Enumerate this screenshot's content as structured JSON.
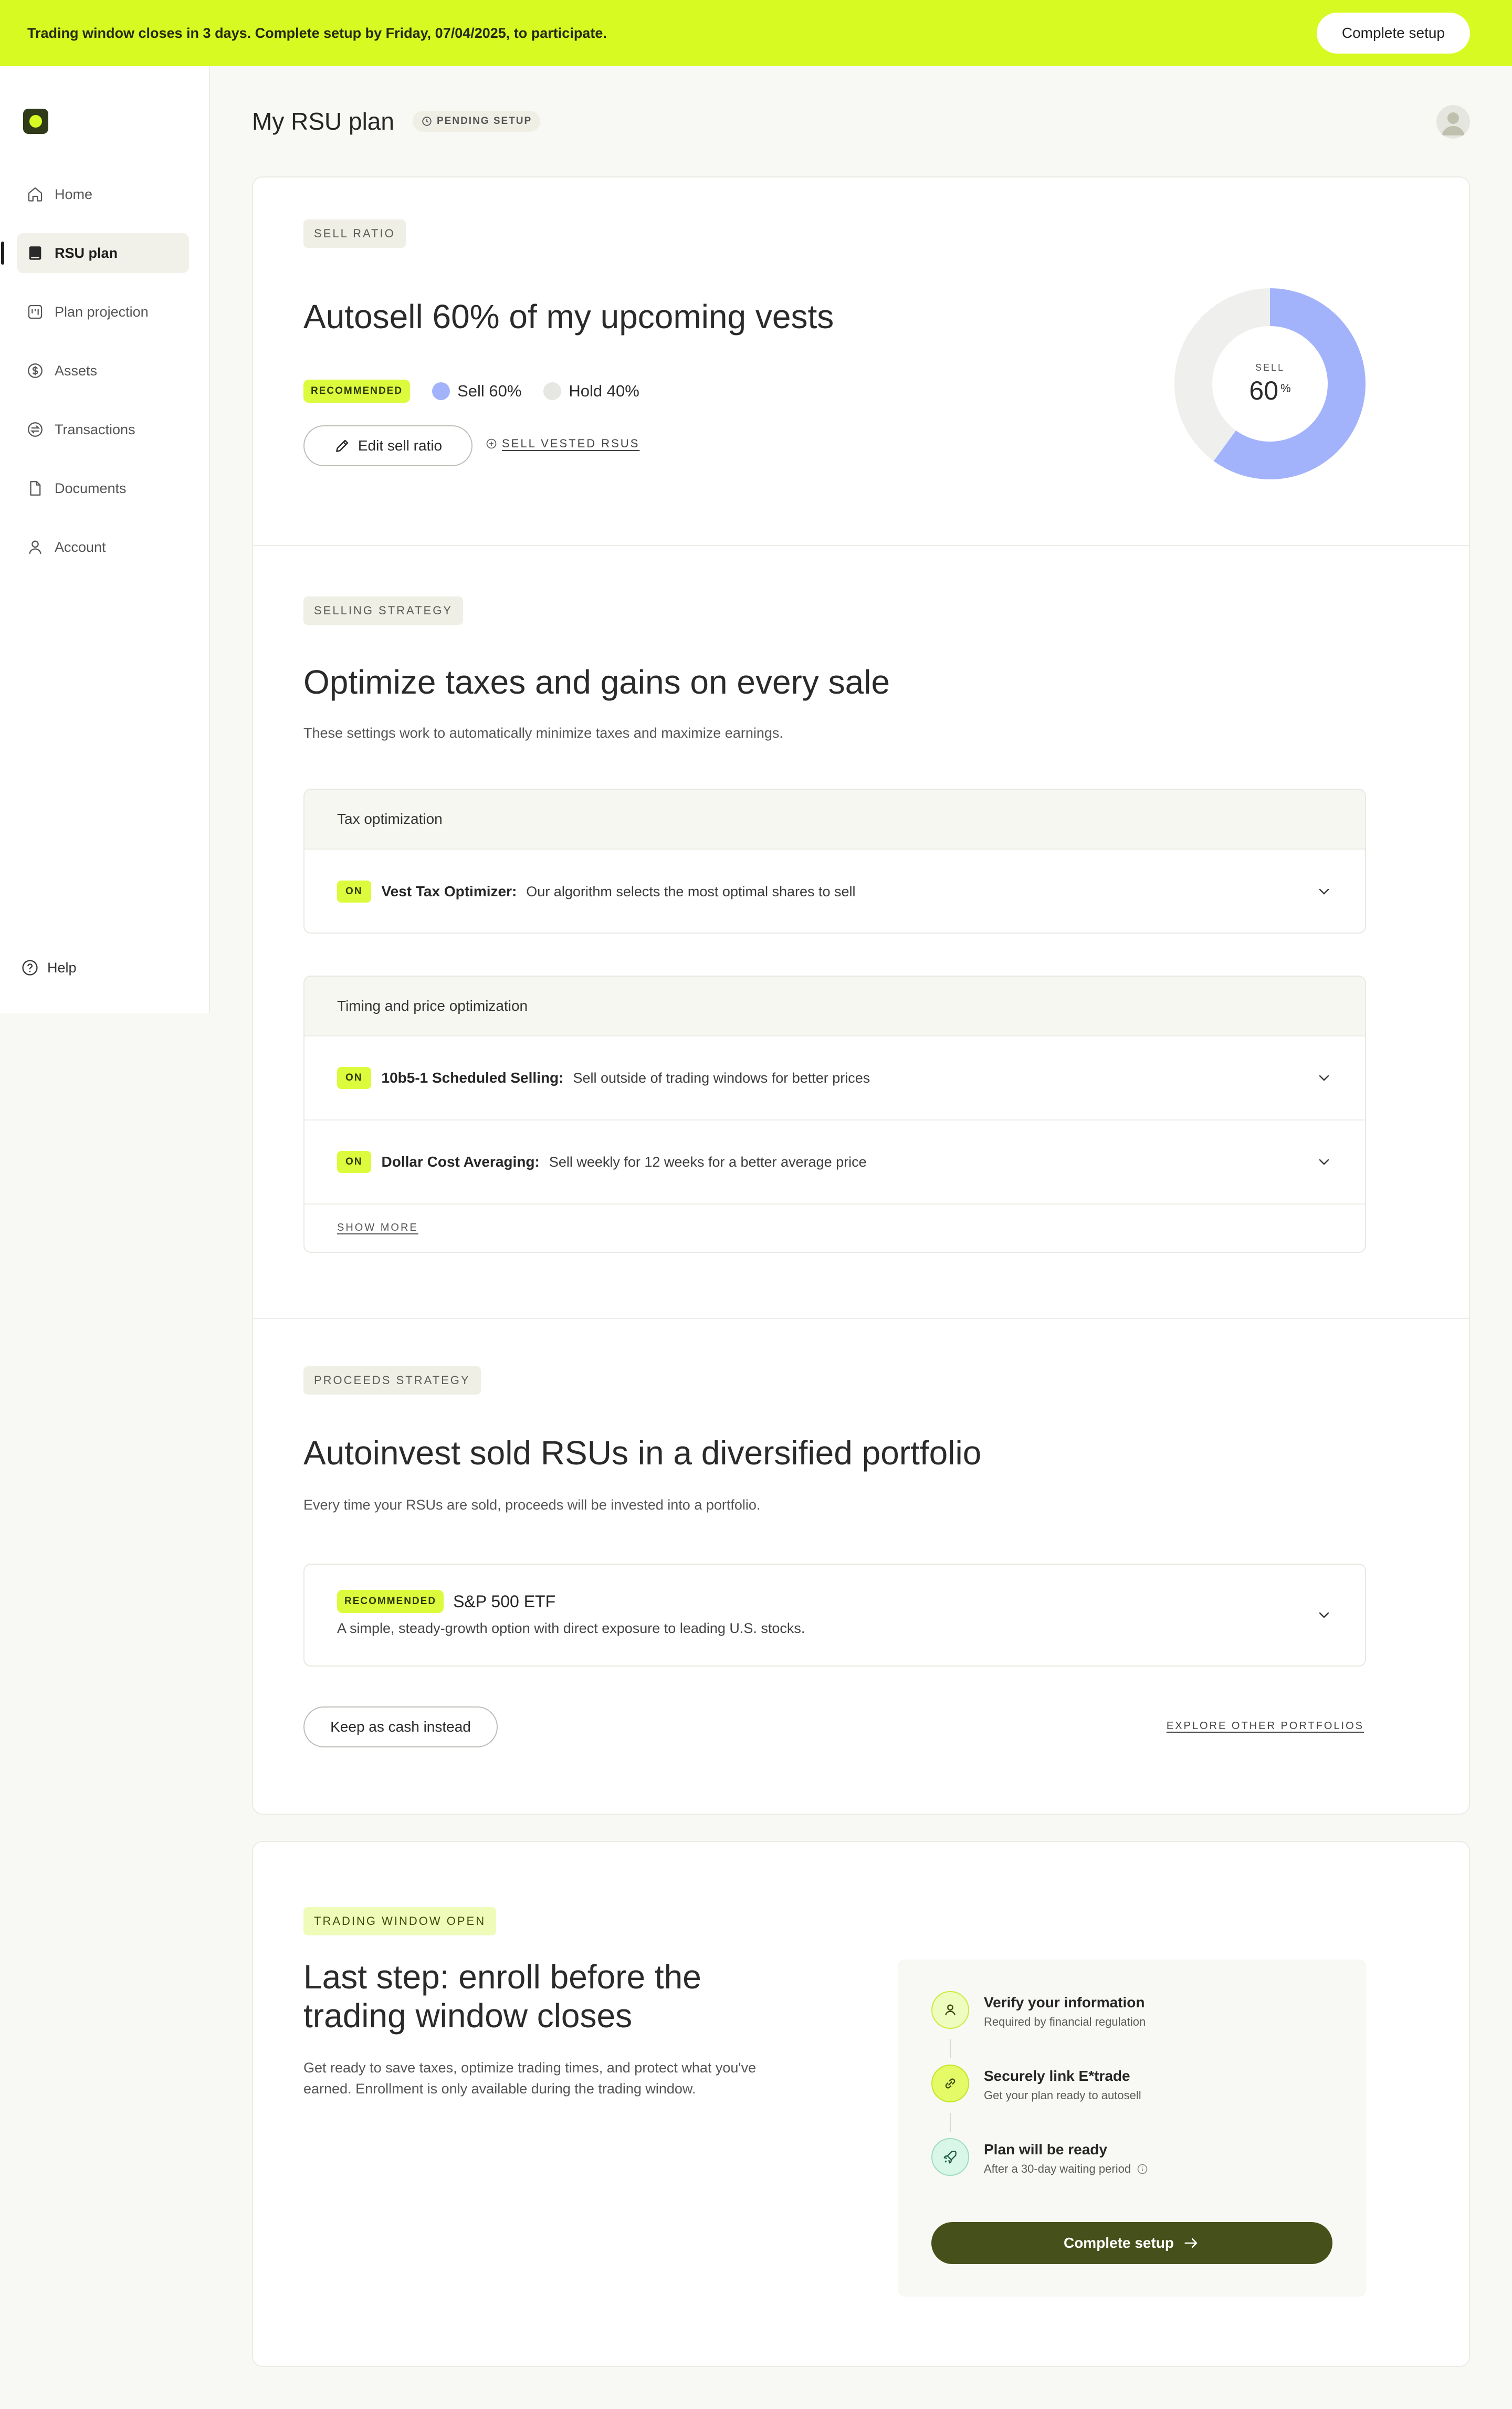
{
  "banner": {
    "text": "Trading window closes in 3 days. Complete setup by Friday, 07/04/2025, to participate.",
    "button": "Complete setup",
    "color": "#d7fa23"
  },
  "sidebar": {
    "items": [
      {
        "label": "Home",
        "icon": "home-icon"
      },
      {
        "label": "RSU plan",
        "icon": "book-icon",
        "active": true
      },
      {
        "label": "Plan projection",
        "icon": "projection-icon"
      },
      {
        "label": "Assets",
        "icon": "dollar-icon"
      },
      {
        "label": "Transactions",
        "icon": "transfer-icon"
      },
      {
        "label": "Documents",
        "icon": "document-icon"
      },
      {
        "label": "Account",
        "icon": "user-icon"
      }
    ],
    "help": "Help"
  },
  "header": {
    "title": "My RSU plan",
    "status": "PENDING SETUP"
  },
  "sell_ratio": {
    "tag": "SELL RATIO",
    "heading": "Autosell 60% of my upcoming vests",
    "recommended": "RECOMMENDED",
    "sell_legend": "Sell 60%",
    "hold_legend": "Hold 40%",
    "edit_button": "Edit sell ratio",
    "sell_vested_link": "SELL VESTED RSUS",
    "donut_label": "SELL",
    "donut_value": "60",
    "donut_unit": "%",
    "sell_fraction": 0.6,
    "sell_color": "#a3b3fb",
    "hold_color": "#efefed"
  },
  "selling_strategy": {
    "tag": "SELLING STRATEGY",
    "heading": "Optimize taxes and gains on every sale",
    "description": "These settings work to automatically minimize taxes and maximize earnings.",
    "groups": [
      {
        "title": "Tax optimization",
        "options": [
          {
            "status": "ON",
            "title": "Vest Tax Optimizer:",
            "description": "Our algorithm selects the most optimal shares to sell"
          }
        ]
      },
      {
        "title": "Timing and price optimization",
        "options": [
          {
            "status": "ON",
            "title": "10b5-1 Scheduled Selling:",
            "description": "Sell outside of trading windows for better prices"
          },
          {
            "status": "ON",
            "title": "Dollar Cost Averaging:",
            "description": "Sell weekly for 12 weeks for a better average price"
          }
        ],
        "show_more": "SHOW MORE"
      }
    ]
  },
  "proceeds_strategy": {
    "tag": "PROCEEDS STRATEGY",
    "heading": "Autoinvest sold RSUs in a diversified portfolio",
    "description": "Every time your RSUs are sold, proceeds will be invested into a portfolio.",
    "portfolio": {
      "badge": "RECOMMENDED",
      "name": "S&P 500 ETF",
      "description": "A simple, steady-growth option with direct exposure to leading U.S. stocks."
    },
    "cash_button": "Keep as cash instead",
    "explore_link": "EXPLORE OTHER PORTFOLIOS"
  },
  "enroll": {
    "tag": "TRADING WINDOW OPEN",
    "heading_line1": "Last step: enroll before the",
    "heading_line2": "trading window closes",
    "description_line1": "Get ready to save taxes, optimize trading times, and protect what you've",
    "description_line2": "earned. Enrollment is only available during the trading window.",
    "steps": [
      {
        "title": "Verify your information",
        "subtitle": "Required by financial regulation",
        "icon": "user-icon"
      },
      {
        "title": "Securely link E*trade",
        "subtitle": "Get your plan ready to autosell",
        "icon": "link-icon"
      },
      {
        "title": "Plan will be ready",
        "subtitle": "After a 30-day waiting period",
        "icon": "rocket-icon"
      }
    ],
    "button": "Complete setup",
    "button_color": "#46501a"
  }
}
